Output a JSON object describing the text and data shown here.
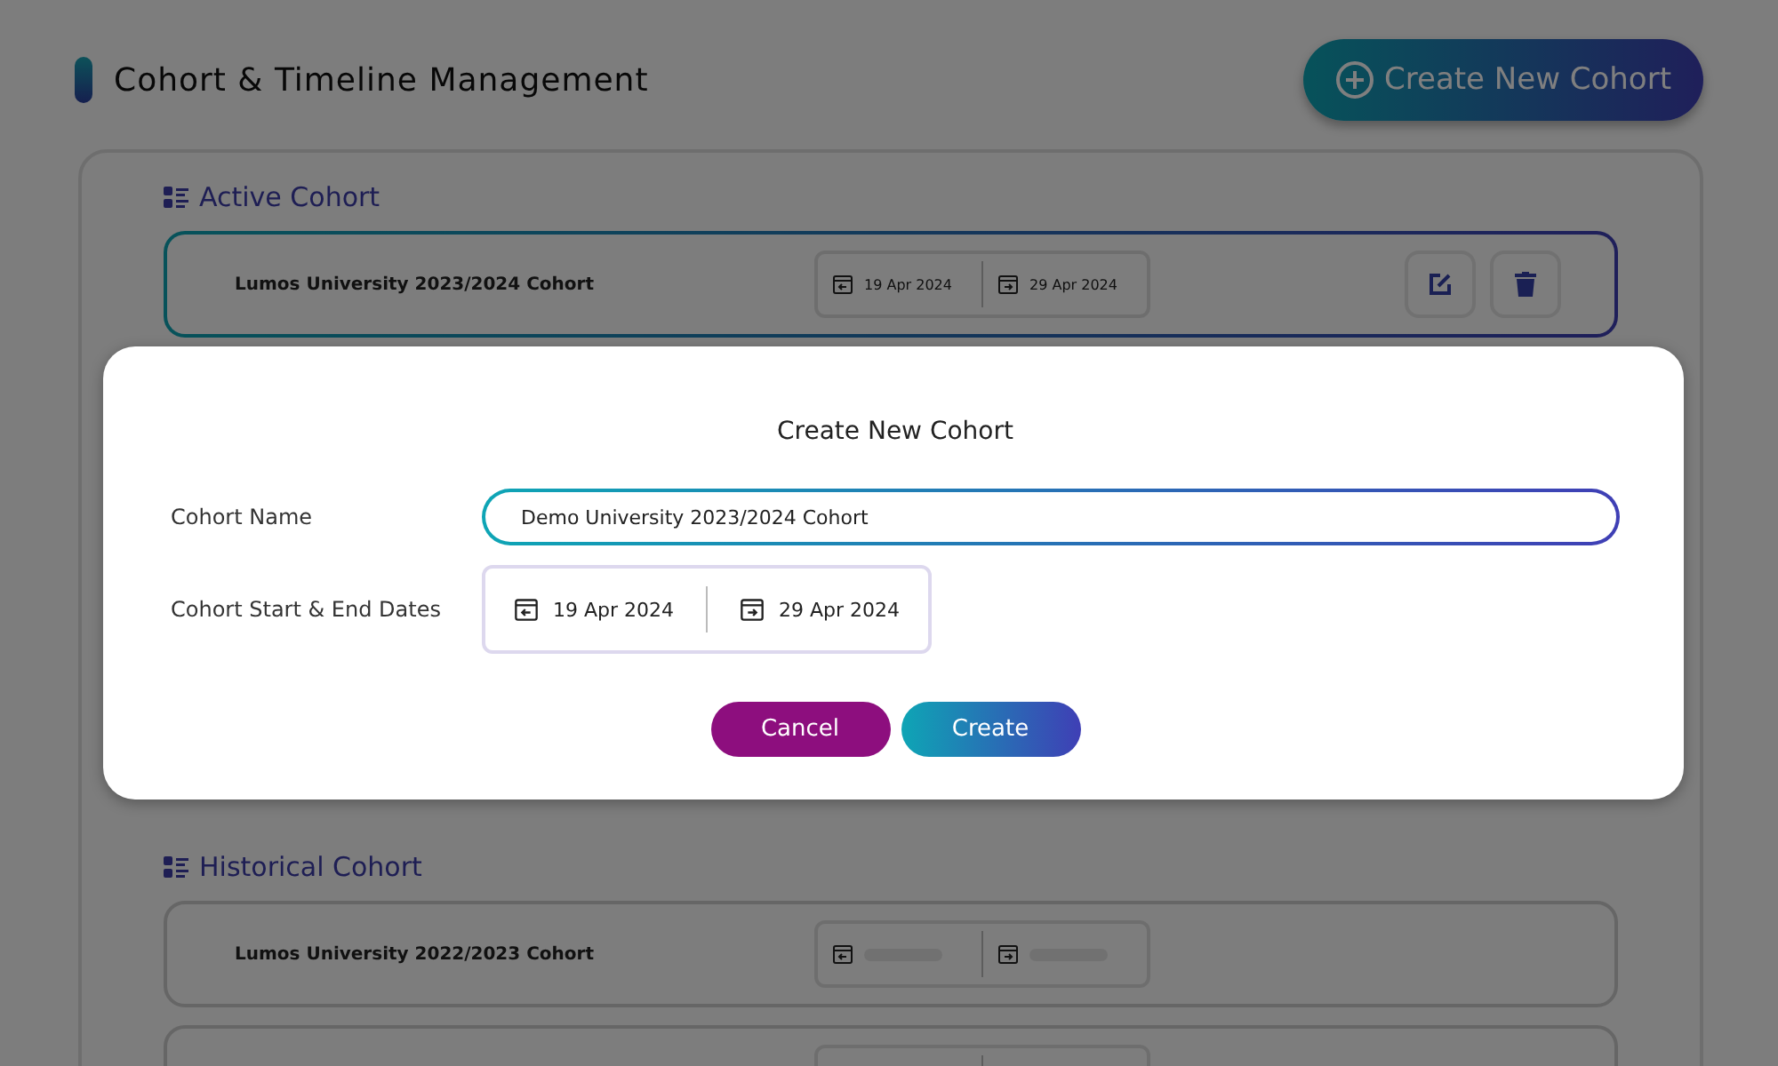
{
  "header": {
    "title": "Cohort & Timeline Management",
    "create_button": "Create New Cohort"
  },
  "active": {
    "heading": "Active Cohort",
    "rows": [
      {
        "name": "Lumos University 2023/2024 Cohort",
        "loading": false,
        "start": "19 Apr 2024",
        "end": "29 Apr 2024",
        "actions": true
      }
    ]
  },
  "historical": {
    "heading": "Historical Cohort",
    "rows": [
      {
        "name": "Lumos University 2022/2023 Cohort",
        "loading": true
      },
      {}
    ]
  },
  "modal": {
    "open": true,
    "title": "Create New Cohort",
    "name_label": "Cohort Name",
    "name_value": "Demo University 2023/2024 Cohort",
    "dates_label": "Cohort Start & End Dates",
    "start": "19 Apr 2024",
    "end": "29 Apr 2024",
    "cancel": "Cancel",
    "submit": "Create"
  }
}
